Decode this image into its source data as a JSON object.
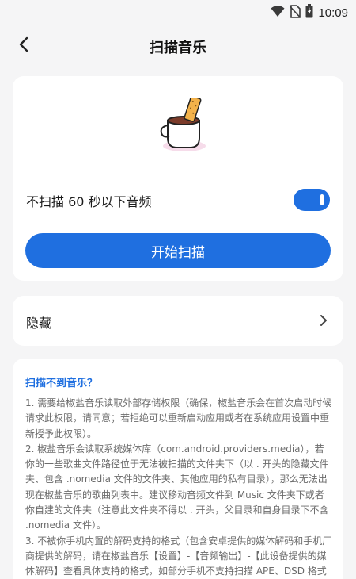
{
  "status_bar": {
    "time": "10:09",
    "icons": [
      "wifi-icon",
      "no-sim-icon",
      "battery-icon"
    ]
  },
  "app_bar": {
    "back_icon": "chevron-left-icon",
    "title": "扫描音乐"
  },
  "scan_card": {
    "illustration": "coffee-cup-icon",
    "toggle_label": "不扫描 60 秒以下音频",
    "toggle_on": true,
    "start_button": "开始扫描"
  },
  "hidden_card": {
    "label": "隐藏",
    "chevron_icon": "chevron-right-icon"
  },
  "help_card": {
    "title": "扫描不到音乐？",
    "paragraphs": [
      "1. 需要给椒盐音乐读取外部存储权限（确保，椒盐音乐会在首次启动时候请求此权限，请同意；若拒绝可以重新启动应用或者在系统应用设置中重新授予此权限）。",
      "2. 椒盐音乐会读取系统媒体库（com.android.providers.media），若你的一些歌曲文件路径位于无法被扫描的文件夹下（以 . 开头的隐藏文件夹、包含 .nomedia 文件的文件夹、其他应用的私有目录），那么无法出现在椒盐音乐的歌曲列表中。建议移动音频文件到 Music 文件夹下或者你自建的文件夹（注意此文件夹不得以 . 开头，父目录和自身目录下不含 .nomedia 文件）。",
      "3. 不被你手机内置的解码支持的格式（包含安卓提供的媒体解码和手机厂商提供的解码，请在椒盐音乐【设置】-【音频输出】-【此设备提供的媒体解码】查看具体支持的格式，如部分手机不支持扫描 APE、DSD 格式"
    ]
  },
  "colors": {
    "accent": "#1f6fe0",
    "background": "#f5f5f6",
    "card": "#ffffff"
  }
}
